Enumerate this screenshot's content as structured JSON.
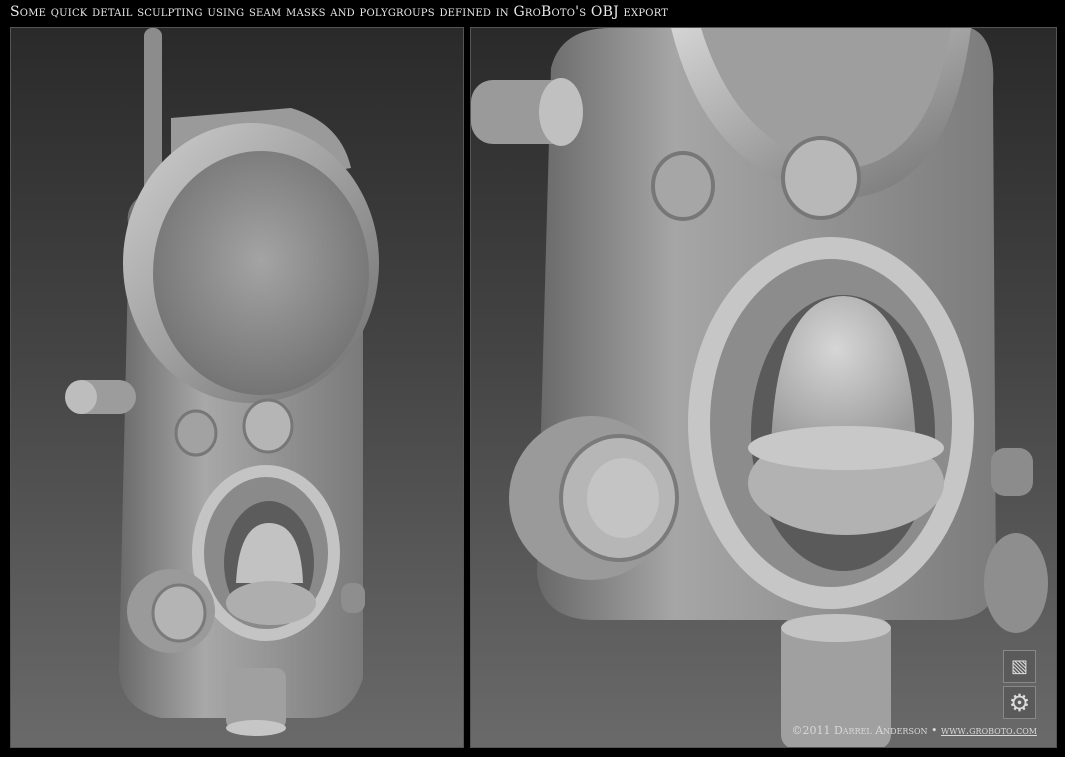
{
  "header": {
    "title": "Some quick detail sculpting using seam masks and polygroups defined in GroBoto's OBJ export"
  },
  "footer": {
    "copyright": "©2011 Darrel Anderson",
    "separator": "•",
    "website": "www.groboto.com"
  },
  "logos": {
    "top_icon": "square-slash-icon",
    "bottom_icon": "gear-icon"
  },
  "colors": {
    "background": "#000000",
    "sculpt_gray": "#9a9a9a"
  }
}
